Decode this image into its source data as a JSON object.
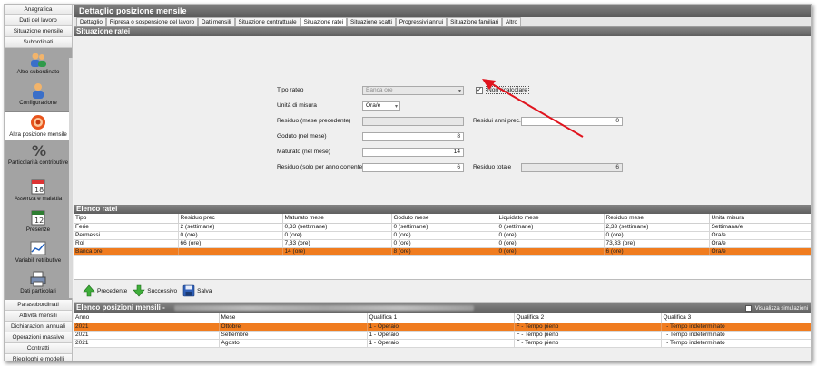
{
  "sidebar": {
    "top_buttons": [
      "Anagrafica",
      "Dati del lavoro",
      "Situazione mensile",
      "Subordinati"
    ],
    "icon_items": [
      {
        "label": "Altro subordinato",
        "icon": "users-icon"
      },
      {
        "label": "Configurazione",
        "icon": "person-config-icon"
      },
      {
        "label": "Altra posizione mensile",
        "icon": "target-icon"
      },
      {
        "label": "Particolarità contributive",
        "icon": "percent-icon"
      },
      {
        "label": "Assenza e malattia",
        "icon": "calendar-icon"
      },
      {
        "label": "Presenze",
        "icon": "calendar-check-icon"
      },
      {
        "label": "Variabili retributive",
        "icon": "chart-icon"
      },
      {
        "label": "Dati particolari",
        "icon": "printer-icon"
      }
    ],
    "bottom_buttons": [
      "Parasubordinati",
      "Attività mensili",
      "Dichiarazioni annuali",
      "Operazioni massive",
      "Contratti",
      "Riepiloghi e modelli"
    ]
  },
  "window": {
    "title": "Dettaglio posizione mensile"
  },
  "tabs": [
    {
      "label": "Dettaglio"
    },
    {
      "label": "Ripresa o sospensione del lavoro"
    },
    {
      "label": "Dati mensili"
    },
    {
      "label": "Situazione contrattuale"
    },
    {
      "label": "Situazione ratei",
      "active": true
    },
    {
      "label": "Situazione scatti"
    },
    {
      "label": "Progressivi annui"
    },
    {
      "label": "Situazione familiari"
    },
    {
      "label": "Altro"
    }
  ],
  "situazione": {
    "header": "Situazione ratei",
    "tipo_rateo_label": "Tipo rateo",
    "tipo_rateo_value": "Banca ore",
    "non_ricalcolare_label": "Non ricalcolare",
    "non_ricalcolare_checked": true,
    "unita_label": "Unità di misura",
    "unita_value": "Ora/e",
    "residuo_prec_label": "Residuo (mese precedente)",
    "residuo_prec_value": "",
    "residui_anni_label": "Residui anni prec.",
    "residui_anni_value": "0",
    "goduto_label": "Goduto (nel mese)",
    "goduto_value": "8",
    "maturato_label": "Maturato (nel mese)",
    "maturato_value": "14",
    "residuo_anno_label": "Residuo (solo per anno corrente)",
    "residuo_anno_value": "6",
    "residuo_totale_label": "Residuo totale",
    "residuo_totale_value": "6",
    "annotation_color": "#e0141e"
  },
  "elenco_ratei": {
    "header": "Elenco ratei",
    "columns": [
      "Tipo",
      "Residuo prec",
      "Maturato mese",
      "Goduto mese",
      "Liquidato mese",
      "Residuo mese",
      "Unità misura"
    ],
    "rows": [
      [
        "Ferie",
        "2 (settimane)",
        "0,33 (settimane)",
        "0 (settimane)",
        "0 (settimane)",
        "2,33 (settimane)",
        "Settimana/e"
      ],
      [
        "Permessi",
        "0 (ore)",
        "0 (ore)",
        "0 (ore)",
        "0 (ore)",
        "0 (ore)",
        "Ora/e"
      ],
      [
        "Rol",
        "66 (ore)",
        "7,33 (ore)",
        "0 (ore)",
        "0 (ore)",
        "73,33 (ore)",
        "Ora/e"
      ],
      [
        "Banca ore",
        "",
        "14 (ore)",
        "8 (ore)",
        "0 (ore)",
        "6 (ore)",
        "Ora/e"
      ]
    ],
    "selected_row": 3,
    "selection_color": "#f07c1f"
  },
  "toolbar": {
    "precedente": "Precedente",
    "successivo": "Successivo",
    "salva": "Salva"
  },
  "elenco_mensili": {
    "header": "Elenco posizioni mensili -",
    "visualizza_label": "Visualizza simulazioni",
    "columns": [
      "Anno",
      "Mese",
      "Qualifica 1",
      "Qualifica 2",
      "Qualifica 3"
    ],
    "rows": [
      [
        "2021",
        "Ottobre",
        "1 - Operaio",
        "F - Tempo pieno",
        "I - Tempo indeterminato"
      ],
      [
        "2021",
        "Settembre",
        "1 - Operaio",
        "F - Tempo pieno",
        "I - Tempo indeterminato"
      ],
      [
        "2021",
        "Agosto",
        "1 - Operaio",
        "F - Tempo pieno",
        "I - Tempo indeterminato"
      ]
    ],
    "selected_row": 0
  }
}
